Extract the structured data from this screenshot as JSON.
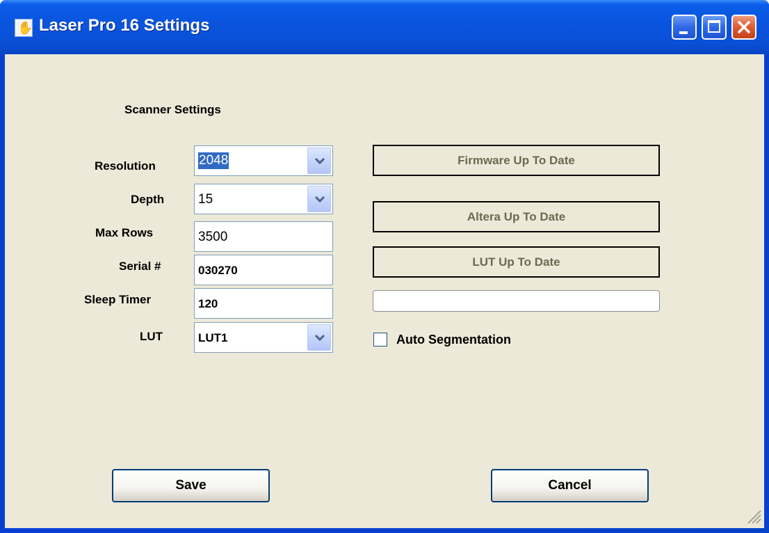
{
  "window": {
    "title": "Laser Pro 16 Settings",
    "app_icon": "laser-pro-app-icon",
    "controls": [
      "minimize-icon",
      "maximize-icon",
      "close-icon"
    ]
  },
  "scanner_settings": {
    "heading": "Scanner Settings",
    "resolution": {
      "label": "Resolution",
      "value": "2048",
      "icon": "chevron-down-icon"
    },
    "depth": {
      "label": "Depth",
      "value": "15",
      "icon": "chevron-down-icon"
    },
    "max_rows": {
      "label": "Max Rows",
      "value": "3500"
    },
    "serial": {
      "label": "Serial #",
      "value": "030270"
    },
    "sleep_timer": {
      "label": "Sleep Timer",
      "value": "120"
    },
    "lut": {
      "label": "LUT",
      "value": "LUT1",
      "icon": "chevron-down-icon"
    }
  },
  "status": {
    "firmware": "Firmware Up To Date",
    "altera": "Altera Up To Date",
    "lut": "LUT Up To Date",
    "progress_value": 0
  },
  "options": {
    "auto_segmentation": {
      "label": "Auto Segmentation",
      "checked": false
    }
  },
  "actions": {
    "save": "Save",
    "cancel": "Cancel"
  },
  "colors": {
    "titlebar": "#0a55df",
    "dialog_bg": "#ece9d8",
    "status_text": "#6b6a4f",
    "selection": "#316ac5"
  }
}
